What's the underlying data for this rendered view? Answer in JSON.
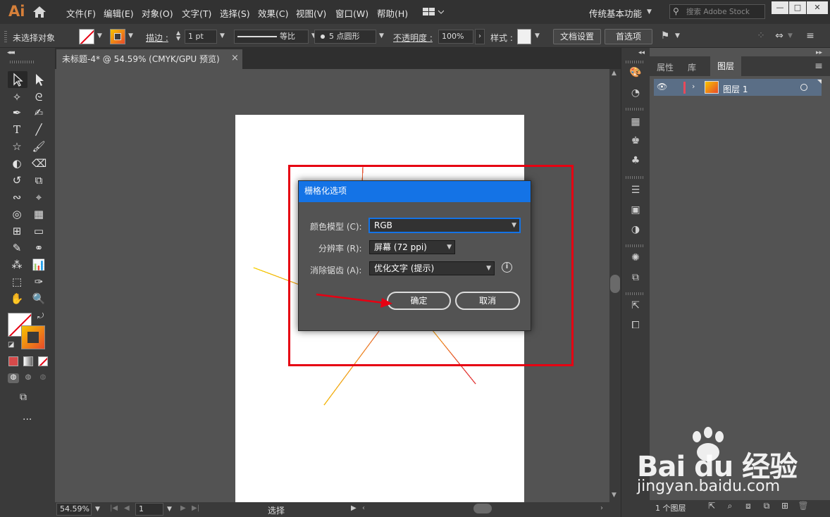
{
  "menubar": {
    "logo": "Ai",
    "items": [
      "文件(F)",
      "编辑(E)",
      "对象(O)",
      "文字(T)",
      "选择(S)",
      "效果(C)",
      "视图(V)",
      "窗口(W)",
      "帮助(H)"
    ],
    "workspace": "传统基本功能",
    "search_placeholder": "搜索 Adobe Stock",
    "window_controls": [
      "—",
      "□",
      "✕"
    ]
  },
  "control_bar": {
    "selection_status": "未选择对象",
    "stroke_label": "描边 :",
    "stroke_value": "1 pt",
    "stroke_profile": "等比",
    "brush": "5 点圆形",
    "opacity_label": "不透明度 :",
    "opacity_value": "100%",
    "style_label": "样式 :",
    "doc_settings": "文档设置",
    "preferences": "首选项"
  },
  "document": {
    "tab_title": "未标题-4* @ 54.59% (CMYK/GPU 预览)",
    "tab_close": "×"
  },
  "status_bar": {
    "zoom": "54.59%",
    "artboard_number": "1",
    "tool_name": "选择"
  },
  "panel": {
    "tabs": [
      "属性",
      "库",
      "图层"
    ],
    "active_tab": "图层",
    "layer_name": "图层 1",
    "layer_count": "1 个图层"
  },
  "dialog": {
    "title": "栅格化选项",
    "color_model_label": "颜色模型 (C):",
    "color_model_value": "RGB",
    "resolution_label": "分辨率 (R):",
    "resolution_value": "屏幕 (72 ppi)",
    "antialias_label": "消除锯齿 (A):",
    "antialias_value": "优化文字 (提示)",
    "ok": "确定",
    "cancel": "取消"
  },
  "watermark": {
    "text": "Bai du 经验",
    "url": "jingyan.baidu.com"
  },
  "colors": {
    "accent": "#1473e6",
    "annotation_red": "#e60012",
    "star_yellow": "#f5c400",
    "star_orange": "#ef8a2a",
    "star_red": "#e23d3d"
  }
}
